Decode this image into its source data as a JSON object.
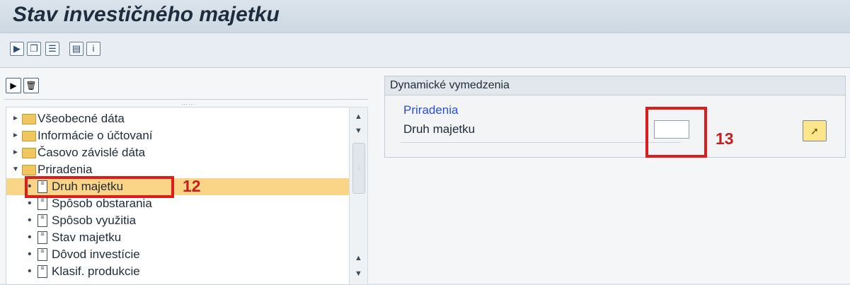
{
  "window": {
    "title": "Stav investičného majetku"
  },
  "toolbar": {
    "icons": [
      "execute-icon",
      "copy-icon",
      "selection-options-icon",
      "variant-icon",
      "info-icon"
    ]
  },
  "left_toolbar": {
    "icons": [
      "expand-icon",
      "delete-icon"
    ]
  },
  "tree": {
    "items": [
      {
        "label": "Všeobecné dáta",
        "type": "folder",
        "state": "collapsed"
      },
      {
        "label": "Informácie o účtovaní",
        "type": "folder",
        "state": "collapsed"
      },
      {
        "label": "Časovo závislé dáta",
        "type": "folder",
        "state": "collapsed"
      },
      {
        "label": "Priradenia",
        "type": "folder",
        "state": "expanded"
      },
      {
        "label": "Druh majetku",
        "type": "field",
        "selected": true
      },
      {
        "label": "Spôsob obstarania",
        "type": "field"
      },
      {
        "label": "Spôsob využitia",
        "type": "field"
      },
      {
        "label": "Stav majetku",
        "type": "field"
      },
      {
        "label": "Dôvod investície",
        "type": "field"
      },
      {
        "label": "Klasif. produkcie",
        "type": "field"
      }
    ]
  },
  "panel": {
    "header": "Dynamické vymedzenia",
    "group_title": "Priradenia",
    "field_label": "Druh majetku",
    "field_value": ""
  },
  "annotations": {
    "tree_marker": "12",
    "input_marker": "13",
    "color": "#dd1c1c"
  },
  "colors": {
    "selection": "#fbd587",
    "group_title": "#2a4fd6",
    "folder": "#f0c75e"
  }
}
